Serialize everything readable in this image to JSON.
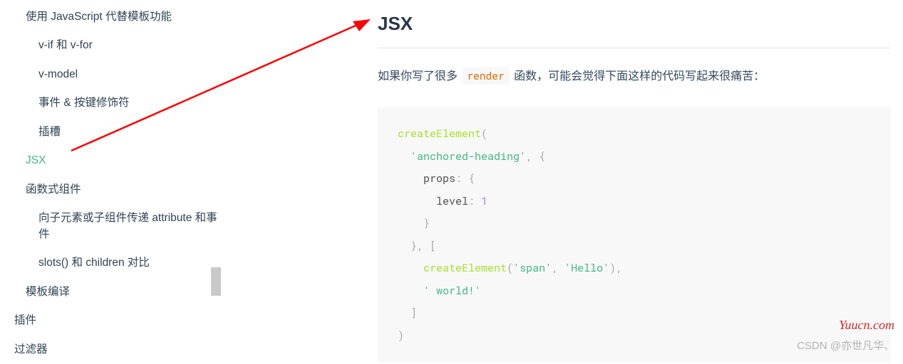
{
  "sidebar": {
    "items": [
      {
        "label": "使用 JavaScript 代替模板功能",
        "level": 1,
        "active": false
      },
      {
        "label": "v-if 和 v-for",
        "level": 2,
        "active": false
      },
      {
        "label": "v-model",
        "level": 2,
        "active": false
      },
      {
        "label": "事件 & 按键修饰符",
        "level": 2,
        "active": false
      },
      {
        "label": "插槽",
        "level": 2,
        "active": false
      },
      {
        "label": "JSX",
        "level": 1,
        "active": true
      },
      {
        "label": "函数式组件",
        "level": 1,
        "active": false
      },
      {
        "label": "向子元素或子组件传递 attribute 和事件",
        "level": 2,
        "active": false
      },
      {
        "label": "slots() 和 children 对比",
        "level": 2,
        "active": false
      },
      {
        "label": "模板编译",
        "level": 1,
        "active": false
      },
      {
        "label": "插件",
        "level": 0,
        "active": false
      },
      {
        "label": "过滤器",
        "level": 0,
        "active": false
      }
    ]
  },
  "content": {
    "heading": "JSX",
    "intro_before": "如果你写了很多 ",
    "intro_code": "render",
    "intro_after": " 函数，可能会觉得下面这样的代码写起来很痛苦：",
    "code": {
      "l1_fn": "createElement",
      "l1_p": "(",
      "l2_str": "'anchored-heading'",
      "l2_p": ", {",
      "l3_key": "props",
      "l3_p": ": {",
      "l4_key": "level",
      "l4_p1": ": ",
      "l4_num": "1",
      "l5_p": "}",
      "l6_p": "}, [",
      "l7_fn": "createElement",
      "l7_p1": "(",
      "l7_str1": "'span'",
      "l7_p2": ", ",
      "l7_str2": "'Hello'",
      "l7_p3": "),",
      "l8_str": "' world!'",
      "l9_p": "]",
      "l10_p": ")"
    }
  },
  "watermark": {
    "right": "Yuucn.com",
    "bottom": "CSDN @亦世凡华、"
  }
}
